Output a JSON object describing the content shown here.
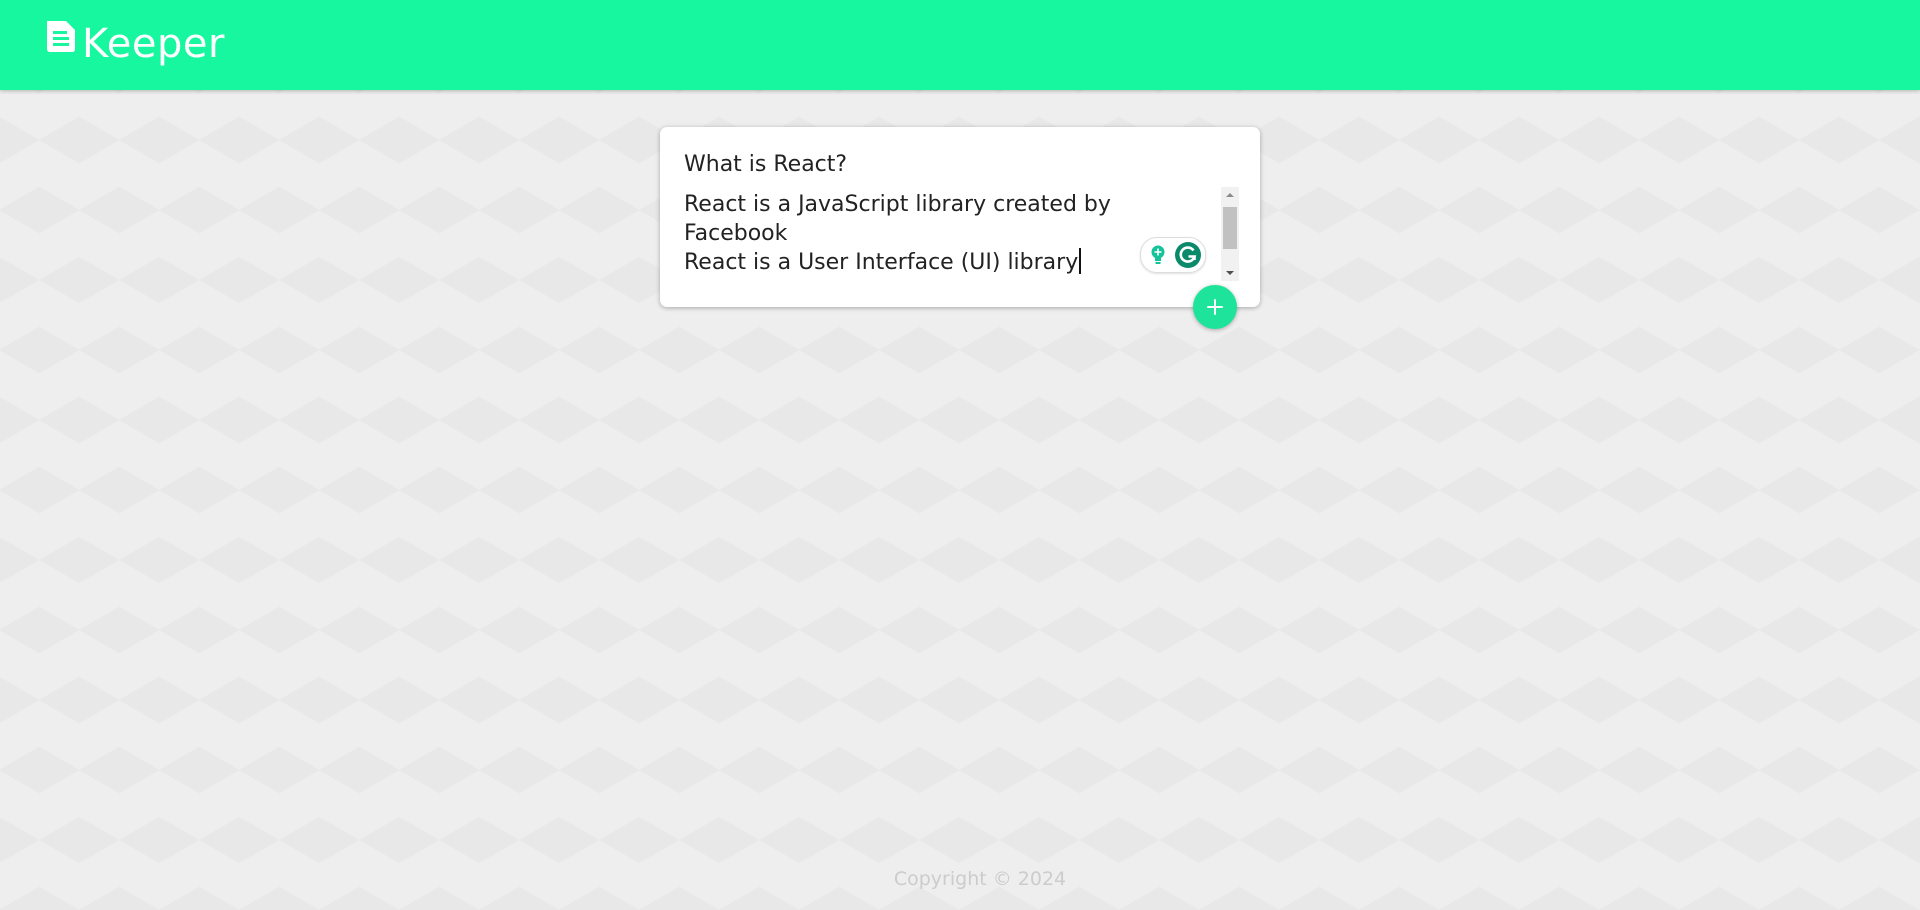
{
  "app": {
    "name": "Keeper",
    "brand_color": "#16f7a0",
    "logo_icon": "note-icon"
  },
  "composer": {
    "title_value": "What is React?",
    "content_lines": [
      "React is a JavaScript library created by",
      "Facebook",
      "React is a User Interface (UI) library"
    ],
    "extension_icons": [
      "lightbulb-icon",
      "grammarly-icon"
    ],
    "add_button_icon": "plus-icon",
    "accent_color": "#1ee39a"
  },
  "footer": {
    "text": "Copyright © 2024"
  }
}
